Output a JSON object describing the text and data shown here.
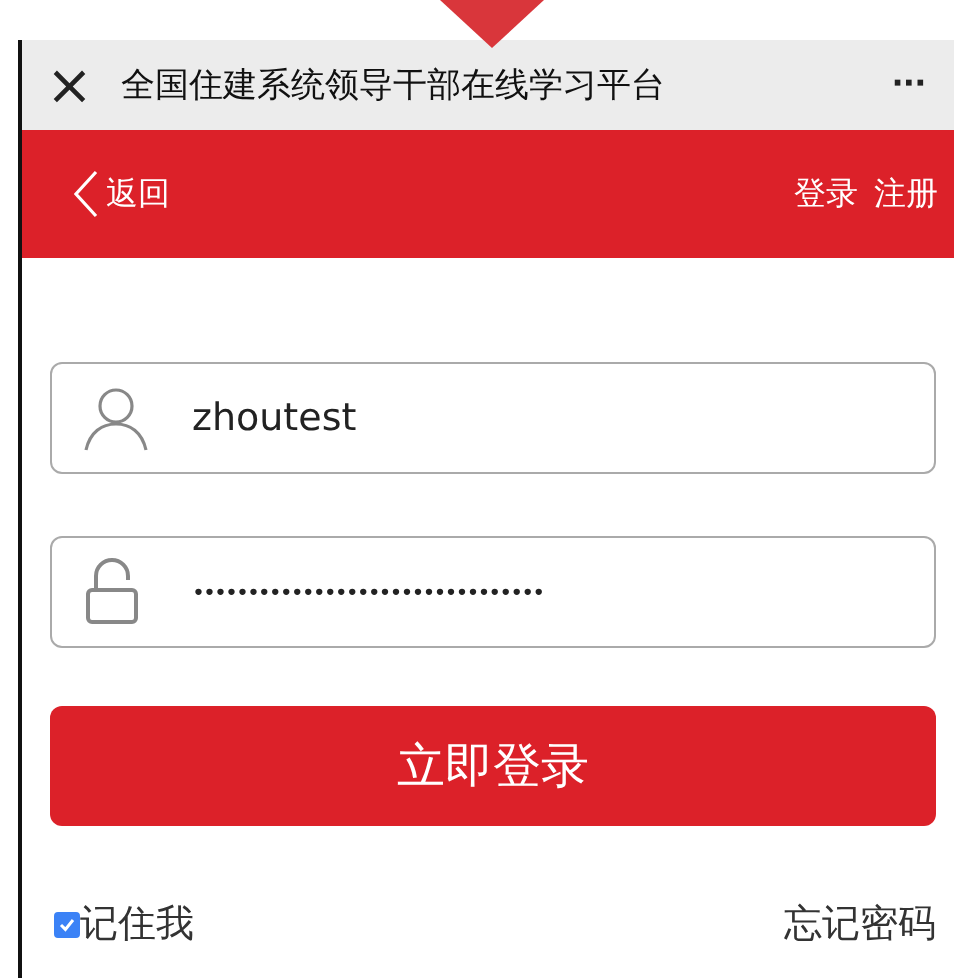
{
  "window": {
    "title": "全国住建系统领导干部在线学习平台",
    "close": "×",
    "more": "···"
  },
  "nav": {
    "back": "返回",
    "login": "登录",
    "register": "注册"
  },
  "form": {
    "username": "zhoutest",
    "password": "••••••••••••••••••••••••••••••••",
    "submit": "立即登录",
    "remember": {
      "label": "记住我",
      "checked": true
    },
    "forgot": "忘记密码"
  }
}
